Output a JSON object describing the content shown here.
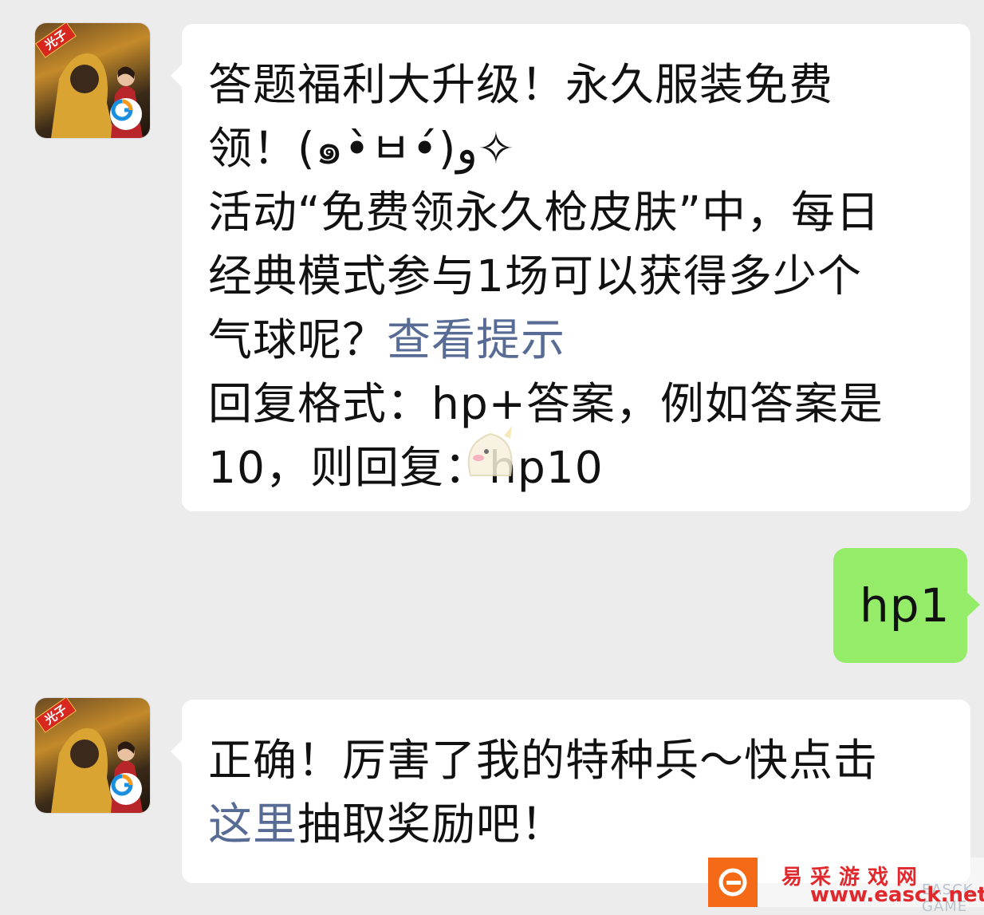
{
  "messages": {
    "m1": {
      "lines": [
        "答题福利大升级！永久服装免费",
        "领！(๑•̀ㅂ•́)و✧",
        "活动“免费领永久枪皮肤”中，每日",
        "经典模式参与1场可以获得多少个"
      ],
      "line5_text": "气球呢？",
      "hint_link": "查看提示",
      "line6": "回复格式：hp+答案，例如答案是",
      "line7": "10，则回复：hp10"
    },
    "m2": {
      "text": "hp1"
    },
    "m3": {
      "line1": "正确！厉害了我的特种兵～快点击",
      "link": "这里",
      "line2_rest": "抽取奖励吧！"
    }
  },
  "avatar": {
    "badge": "光子"
  },
  "watermark": {
    "title": "易采游戏网",
    "url": "www.easck.net",
    "sub": "EASCK GAME"
  },
  "colors": {
    "background": "#ececec",
    "incoming_bubble": "#ffffff",
    "outgoing_bubble": "#95ec69",
    "link": "#576b95",
    "watermark_red": "#e0282d",
    "watermark_orange": "#f46a17"
  }
}
